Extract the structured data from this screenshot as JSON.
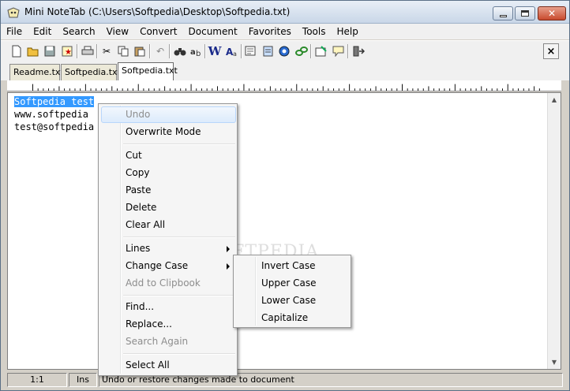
{
  "window": {
    "title": "Mini NoteTab (C:\\Users\\Softpedia\\Desktop\\Softpedia.txt)"
  },
  "menubar": [
    "File",
    "Edit",
    "Search",
    "View",
    "Convert",
    "Document",
    "Favorites",
    "Tools",
    "Help"
  ],
  "toolbar": {
    "close_label": "×"
  },
  "tabs": [
    {
      "label": "Readme.txt",
      "active": false
    },
    {
      "label": "Softpedia.txt",
      "active": false
    },
    {
      "label": "Softpedia.txt",
      "active": true
    }
  ],
  "editor": {
    "lines": [
      "Softpedia test",
      "www.softpedia",
      "test@softpedia"
    ]
  },
  "context_menu": {
    "items": [
      {
        "label": "Undo",
        "disabled": true,
        "hover": true
      },
      {
        "label": "Overwrite Mode"
      },
      {
        "label": "Cut"
      },
      {
        "label": "Copy"
      },
      {
        "label": "Paste"
      },
      {
        "label": "Delete"
      },
      {
        "label": "Clear All"
      },
      {
        "label": "Lines",
        "submenu": true
      },
      {
        "label": "Change Case",
        "submenu": true
      },
      {
        "label": "Add to Clipbook",
        "disabled": true
      },
      {
        "label": "Find..."
      },
      {
        "label": "Replace..."
      },
      {
        "label": "Search Again",
        "disabled": true
      },
      {
        "label": "Select All"
      }
    ]
  },
  "change_case_submenu": [
    "Invert Case",
    "Upper Case",
    "Lower Case",
    "Capitalize"
  ],
  "statusbar": {
    "position": "1:1",
    "mode": "Ins",
    "message": "Undo or restore changes made to document"
  },
  "watermark": "SOFTPEDIA"
}
